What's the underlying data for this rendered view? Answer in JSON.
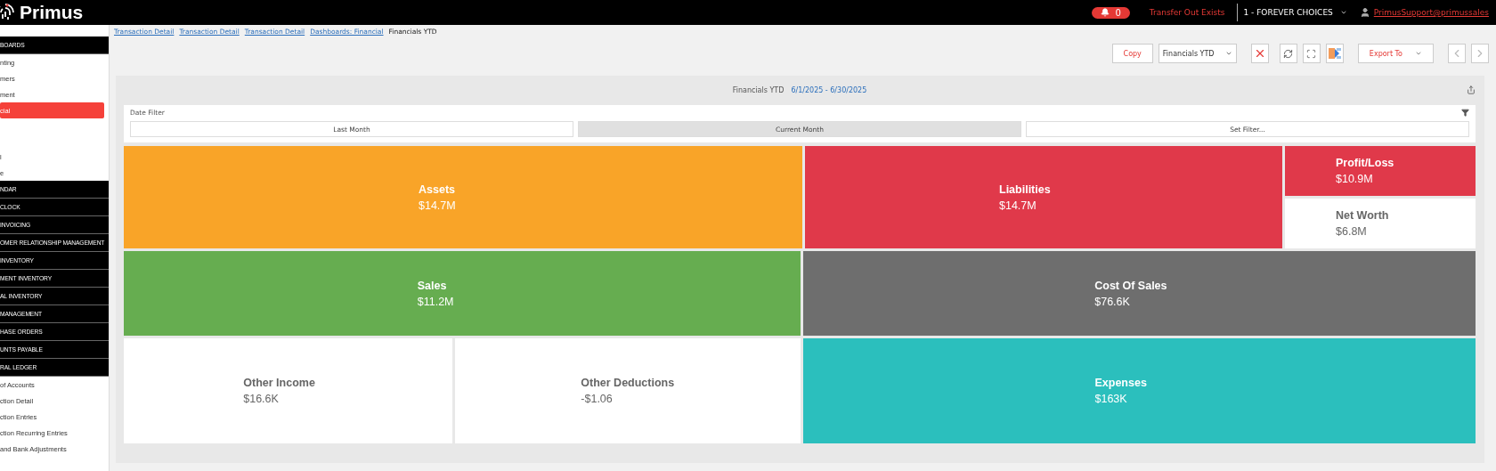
{
  "header": {
    "logo": "Primus",
    "notifications": "0",
    "alert": "Transfer Out Exists",
    "company": "1 - FOREVER CHOICES",
    "user": "PrimusSupport@primussales"
  },
  "sidebar": {
    "items": [
      {
        "kind": "header",
        "label": "BOARDS",
        "selected": false
      },
      {
        "kind": "link",
        "label": "nting",
        "selected": false
      },
      {
        "kind": "link",
        "label": "mers",
        "selected": false
      },
      {
        "kind": "link",
        "label": "ment",
        "selected": false
      },
      {
        "kind": "link",
        "label": "cial",
        "selected": true
      },
      {
        "kind": "link",
        "label": "l",
        "selected": false
      },
      {
        "kind": "link",
        "label": "e",
        "selected": false
      },
      {
        "kind": "header",
        "label": "NDAR",
        "selected": false
      },
      {
        "kind": "header",
        "label": "CLOCK",
        "selected": false
      },
      {
        "kind": "header",
        "label": "INVOICING",
        "selected": false
      },
      {
        "kind": "header",
        "label": "OMER RELATIONSHIP MANAGEMENT",
        "selected": false
      },
      {
        "kind": "header",
        "label": "INVENTORY",
        "selected": false
      },
      {
        "kind": "header",
        "label": "MENT INVENTORY",
        "selected": false
      },
      {
        "kind": "header",
        "label": "AL INVENTORY",
        "selected": false
      },
      {
        "kind": "header",
        "label": "MANAGEMENT",
        "selected": false
      },
      {
        "kind": "header",
        "label": "HASE ORDERS",
        "selected": false
      },
      {
        "kind": "header",
        "label": "UNTS PAYABLE",
        "selected": false
      },
      {
        "kind": "header",
        "label": "RAL LEDGER",
        "selected": false
      },
      {
        "kind": "link",
        "label": "of Accounts",
        "selected": false
      },
      {
        "kind": "link",
        "label": "ction Detail",
        "selected": false
      },
      {
        "kind": "link",
        "label": "ction Entries",
        "selected": false
      },
      {
        "kind": "link",
        "label": "ction Recurring Entries",
        "selected": false
      },
      {
        "kind": "link",
        "label": "and Bank Adjustments",
        "selected": false
      }
    ]
  },
  "breadcrumbs": [
    {
      "label": "Transaction Detail",
      "link": true
    },
    {
      "label": "Transaction Detail",
      "link": true
    },
    {
      "label": "Transaction Detail",
      "link": true
    },
    {
      "label": "Dashboards: Financial",
      "link": true
    },
    {
      "label": "Financials YTD",
      "link": false
    }
  ],
  "toolbar": {
    "copy": "Copy",
    "dashboard_select": "Financials YTD",
    "export": "Export To"
  },
  "dashboard": {
    "title": "Financials YTD",
    "range": "6/1/2025 - 6/30/2025",
    "date_filter": {
      "label": "Date Filter",
      "options": [
        {
          "label": "Last Month",
          "selected": false
        },
        {
          "label": "Current Month",
          "selected": true
        },
        {
          "label": "Set Filter...",
          "selected": false
        }
      ]
    },
    "tile_rows": [
      [
        {
          "title": "Assets",
          "value": "$14.7M",
          "color": "#f9a428"
        },
        {
          "title": "Liabilities",
          "value": "$14.7M",
          "color": "#e0394a"
        },
        {
          "kind": "stack",
          "tiles": [
            {
              "title": "Profit/Loss",
              "value": "$10.9M",
              "color": "#e0394a"
            },
            {
              "title": "Net Worth",
              "value": "$6.8M",
              "color": "#ffffff"
            }
          ]
        }
      ],
      [
        {
          "title": "Sales",
          "value": "$11.2M",
          "color": "#66ad50"
        },
        {
          "title": "Cost Of Sales",
          "value": "$76.6K",
          "color": "#6e6e6e"
        }
      ],
      [
        {
          "title": "Other Income",
          "value": "$16.6K",
          "color": "#ffffff"
        },
        {
          "title": "Other Deductions",
          "value": "-$1.06",
          "color": "#ffffff"
        },
        {
          "title": "Expenses",
          "value": "$163K",
          "color": "#2bbfbd"
        }
      ]
    ]
  }
}
